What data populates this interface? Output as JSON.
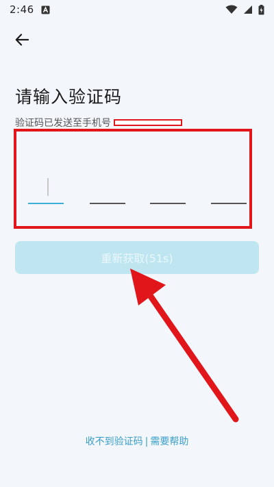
{
  "status_bar": {
    "time": "2:46",
    "left_icons": [
      "a-notification-icon"
    ],
    "right_icons": [
      "wifi-icon",
      "signal-icon",
      "battery-charging-icon"
    ]
  },
  "header": {
    "back_icon": "arrow-left-icon"
  },
  "main": {
    "title": "请输入验证码",
    "subtitle": "验证码已发送至手机号",
    "code_length": 4,
    "active_index": 0
  },
  "resend": {
    "label": "重新获取(51s)"
  },
  "footer": {
    "not_received": "收不到验证码",
    "separator": "|",
    "need_help": "需要帮助"
  },
  "colors": {
    "accent": "#3aaed8",
    "button_disabled": "#bfe6f0",
    "annotation_red": "#e0161b",
    "link": "#3a9ec9"
  }
}
